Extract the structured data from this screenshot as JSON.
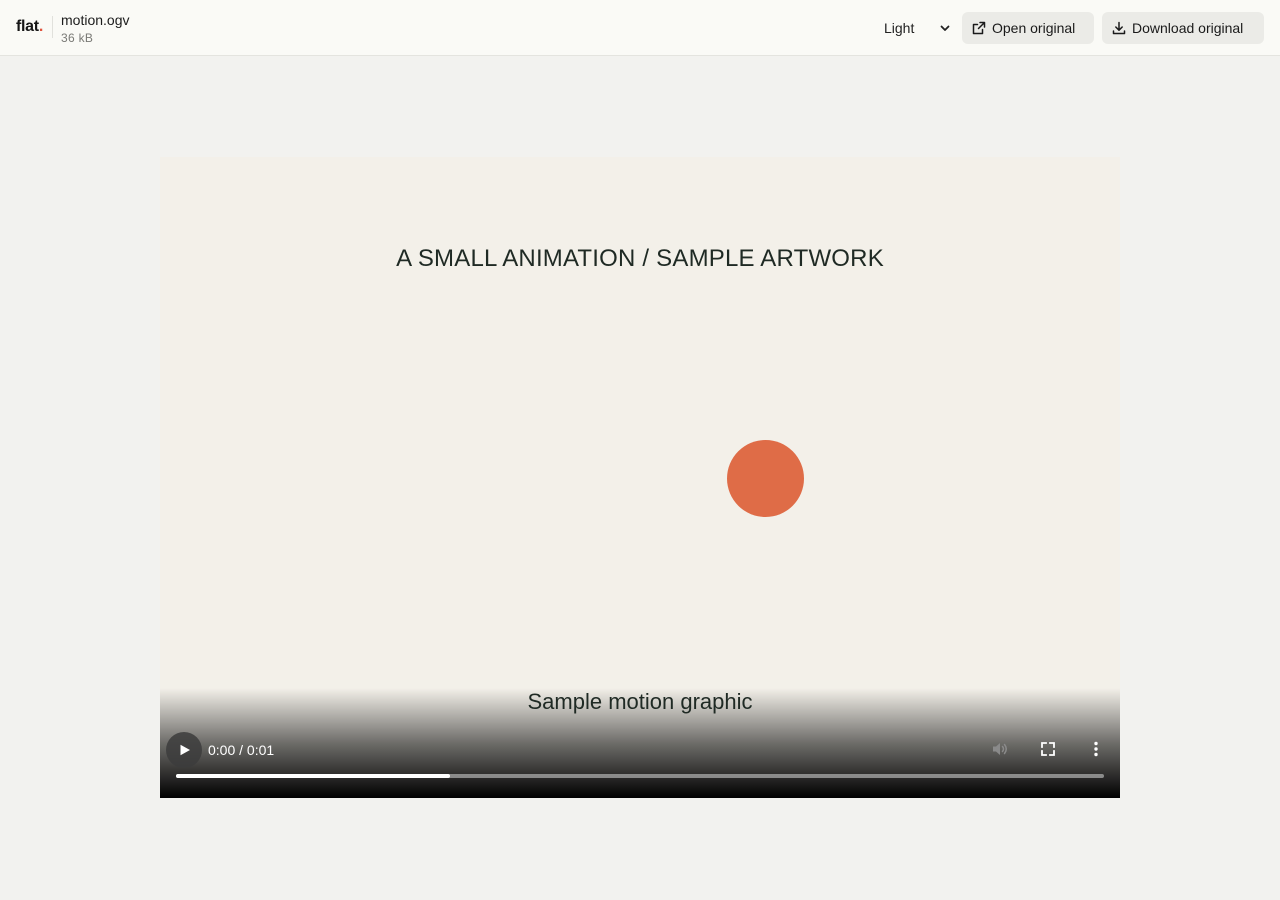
{
  "header": {
    "logo": "flat",
    "logo_dot": ".",
    "filename": "motion.ogv",
    "filesize": "36 kB",
    "theme_value": "Light",
    "open_label": "Open original",
    "download_label": "Download original"
  },
  "video": {
    "title": "A SMALL ANIMATION / SAMPLE ARTWORK",
    "caption": "Sample motion graphic",
    "time": "0:00 / 0:01",
    "progress_fraction": 0.295
  },
  "colors": {
    "accent": "#e0533d",
    "ball": "#df6c47",
    "background": "#f2f2ef",
    "video_background": "#f3f0e9"
  },
  "icons": {
    "open": "external-link-icon",
    "download": "download-icon",
    "chevron": "chevron-down-icon",
    "play": "play-icon",
    "volume": "volume-icon",
    "fullscreen": "fullscreen-icon",
    "more": "more-vertical-icon"
  }
}
